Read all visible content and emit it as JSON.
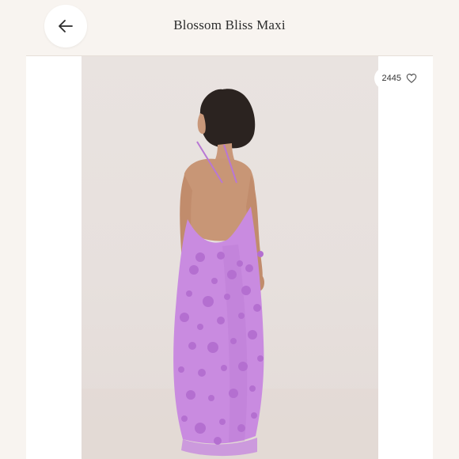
{
  "header": {
    "title": "Blossom Bliss Maxi",
    "back_icon": "arrow-left-icon"
  },
  "listing": {
    "likes_count": "2445",
    "like_icon": "heart-outline-icon",
    "photo_description_icon": "product-photo"
  },
  "colors": {
    "background": "#f8f4f0",
    "dress": "#c98be0",
    "rosette": "#b46fd0"
  }
}
